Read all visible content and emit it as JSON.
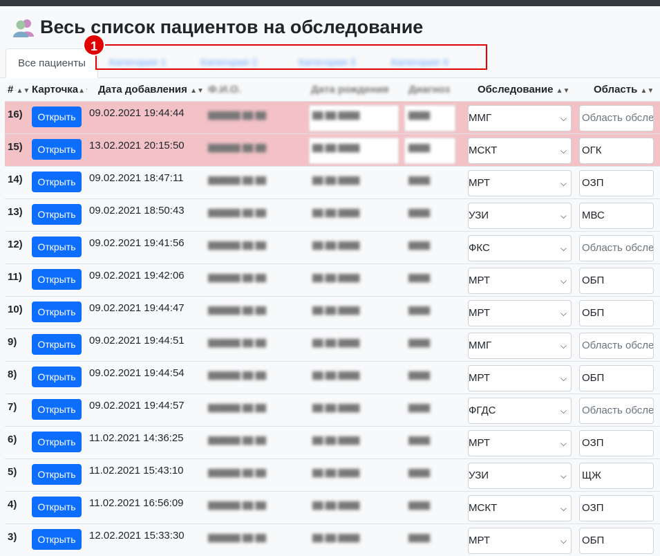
{
  "page": {
    "title": "Весь список пациентов на обследование",
    "title_icon": "users-icon"
  },
  "tabs": [
    {
      "label": "Все пациенты",
      "active": true
    },
    {
      "label": "Категория 1",
      "blurred": true
    },
    {
      "label": "Категория 2",
      "blurred": true
    },
    {
      "label": "Категория 3",
      "blurred": true
    },
    {
      "label": "Категория 4",
      "blurred": true
    }
  ],
  "annotation": {
    "badge": "1",
    "color": "#e00000"
  },
  "columns": {
    "num": "#",
    "card": "Карточка",
    "added": "Дата добавления",
    "fio": "Ф.И.О.",
    "birth": "Дата рождения",
    "diag": "Диагноз",
    "exam": "Обследование",
    "area": "Область"
  },
  "button_label": "Открыть",
  "area_placeholder": "Область обследования",
  "rows": [
    {
      "num": "16)",
      "added": "09.02.2021 19:44:44",
      "exam": "ММГ",
      "area": "",
      "highlight": true
    },
    {
      "num": "15)",
      "added": "13.02.2021 20:15:50",
      "exam": "МСКТ",
      "area": "ОГК",
      "highlight": true
    },
    {
      "num": "14)",
      "added": "09.02.2021 18:47:11",
      "exam": "МРТ",
      "area": "ОЗП"
    },
    {
      "num": "13)",
      "added": "09.02.2021 18:50:43",
      "exam": "УЗИ",
      "area": "МВС"
    },
    {
      "num": "12)",
      "added": "09.02.2021 19:41:56",
      "exam": "ФКС",
      "area": ""
    },
    {
      "num": "11)",
      "added": "09.02.2021 19:42:06",
      "exam": "МРТ",
      "area": "ОБП"
    },
    {
      "num": "10)",
      "added": "09.02.2021 19:44:47",
      "exam": "МРТ",
      "area": "ОБП"
    },
    {
      "num": "9)",
      "added": "09.02.2021 19:44:51",
      "exam": "ММГ",
      "area": ""
    },
    {
      "num": "8)",
      "added": "09.02.2021 19:44:54",
      "exam": "МРТ",
      "area": "ОБП"
    },
    {
      "num": "7)",
      "added": "09.02.2021 19:44:57",
      "exam": "ФГДС",
      "area": ""
    },
    {
      "num": "6)",
      "added": "11.02.2021 14:36:25",
      "exam": "МРТ",
      "area": "ОЗП"
    },
    {
      "num": "5)",
      "added": "11.02.2021 15:43:10",
      "exam": "УЗИ",
      "area": "ЩЖ"
    },
    {
      "num": "4)",
      "added": "11.02.2021 16:56:09",
      "exam": "МСКТ",
      "area": "ОЗП"
    },
    {
      "num": "3)",
      "added": "12.02.2021 15:33:30",
      "exam": "МРТ",
      "area": "ОБП"
    }
  ],
  "colors": {
    "primary_button": "#0d6efd",
    "highlight_row": "#f2c2c7",
    "annotation_red": "#e00000"
  }
}
